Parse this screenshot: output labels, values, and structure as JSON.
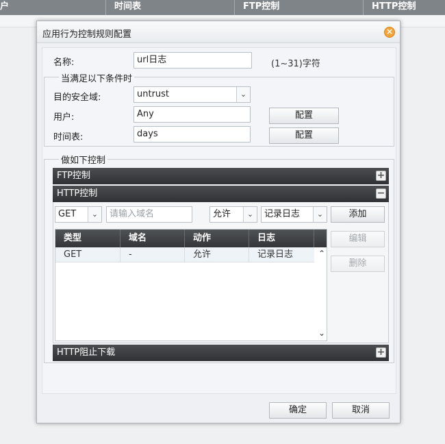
{
  "background": {
    "columns": [
      "户",
      "时间表",
      "FTP控制",
      "HTTP控制"
    ]
  },
  "dialog": {
    "title": "应用行为控制规则配置",
    "close_icon": "close-icon",
    "name": {
      "label": "名称:",
      "value": "url日志",
      "hint": "(1~31)字符"
    },
    "conditions": {
      "legend": "当满足以下条件时",
      "dest_zone": {
        "label": "目的安全域:",
        "value": "untrust"
      },
      "user": {
        "label": "用户:",
        "value": "Any",
        "button": "配置"
      },
      "schedule": {
        "label": "时间表:",
        "value": "days",
        "button": "配置"
      }
    },
    "controls": {
      "legend": "做如下控制",
      "ftp": {
        "label": "FTP控制",
        "toggle": "+"
      },
      "http": {
        "label": "HTTP控制",
        "toggle": "−",
        "method": "GET",
        "domain_placeholder": "请输入域名",
        "action": "允许",
        "log": "记录日志",
        "add_button": "添加",
        "edit_button": "编辑",
        "delete_button": "删除",
        "table": {
          "headers": [
            "类型",
            "域名",
            "动作",
            "日志"
          ],
          "rows": [
            [
              "GET",
              "-",
              "允许",
              "记录日志"
            ]
          ]
        }
      },
      "http_block": {
        "label": "HTTP阻止下载",
        "toggle": "+"
      }
    },
    "footer": {
      "ok": "确定",
      "cancel": "取消"
    }
  }
}
